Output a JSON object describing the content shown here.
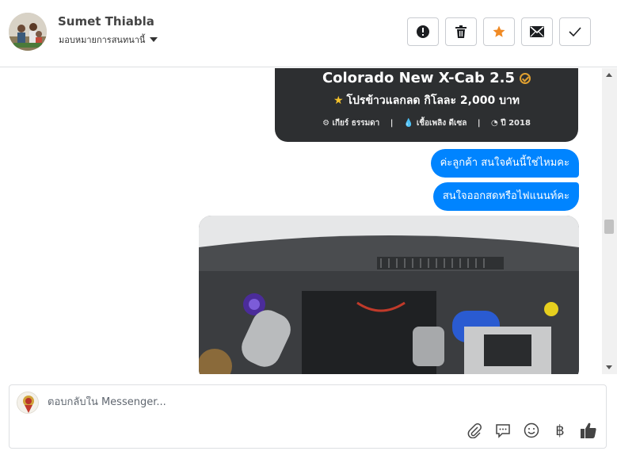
{
  "header": {
    "name": "Sumet Thiabla",
    "assign_label": "มอบหมายการสนทนานี้",
    "actions": [
      "alert-icon",
      "trash-icon",
      "star-icon",
      "mail-icon",
      "check-icon"
    ],
    "star_color": "#f08a24"
  },
  "card": {
    "title": "Colorado New X-Cab 2.5",
    "promo": "โปรข้าวแลกลด กิโลละ 2,000 บาท",
    "specs": {
      "gear": "เกียร์ ธรรมดา",
      "fuel": "เชื้อเพลิง ดีเซล",
      "year": "ปี 2018"
    }
  },
  "messages": [
    {
      "text": "ค่ะลูกค้า สนใจคันนี้ใช่ไหมคะ"
    },
    {
      "text": "สนใจออกสดหรือไฟแนนท์คะ"
    }
  ],
  "photo": {
    "label": "engine-bay-photo"
  },
  "composer": {
    "placeholder": "ตอบกลับใน Messenger...",
    "tools": [
      "attachment-icon",
      "comment-icon",
      "smiley-icon",
      "baht-icon",
      "thumbs-up-icon"
    ],
    "baht_symbol": "฿"
  },
  "colors": {
    "bubble": "#0084ff",
    "card_bg": "#2d2f31",
    "check_accent": "#e0a030"
  }
}
